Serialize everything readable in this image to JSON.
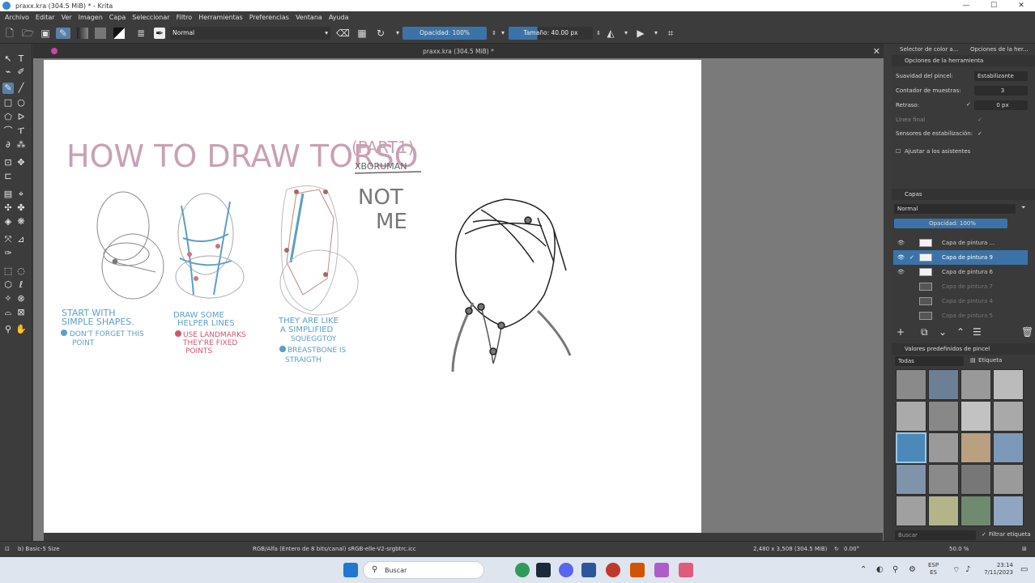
{
  "window": {
    "title": "praxx.kra (304.5 MiB) * - Krita"
  },
  "menu": [
    "Archivo",
    "Editar",
    "Ver",
    "Imagen",
    "Capa",
    "Seleccionar",
    "Filtro",
    "Herramientas",
    "Preferencias",
    "Ventana",
    "Ayuda"
  ],
  "toolbar": {
    "blend_mode": "Normal",
    "opacity": "Opacidad: 100%",
    "size": "Tamaño: 40.00 px"
  },
  "document": {
    "tab_title": "praxx.kra (304.5 MiB) *"
  },
  "canvas_art": {
    "title": "HOW TO DRAW TORSO",
    "part": "(PART1)",
    "author": "XBORUMAN",
    "note_line1": "NOT",
    "note_line2": "ME",
    "caption1_l1": "START WITH",
    "caption1_l2": "SIMPLE SHAPES.",
    "caption1_l3": "DON'T FORGET THIS",
    "caption1_l4": "POINT",
    "caption2_l1": "DRAW SOME",
    "caption2_l2": "HELPER LINES",
    "caption2_l3": "USE LANDMARKS",
    "caption2_l4": "THEY'RE FIXED",
    "caption2_l5": "POINTS",
    "caption3_l1": "THEY ARE LIKE",
    "caption3_l2": "A SIMPLIFIED",
    "caption3_l3": "SQUEGGTOY",
    "caption3_l4": "BREASTBONE IS",
    "caption3_l5": "STRAIGTH"
  },
  "docker": {
    "tab_color": "Selector de color a...",
    "tab_options": "Opciones de la her...",
    "tool_options_title": "Opciones de la herramienta",
    "brush_smoothing_label": "Suavidad del pincel:",
    "brush_smoothing_value": "Estabilizante",
    "sample_count_label": "Contador de muestras:",
    "sample_count_value": "3",
    "delay_label": "Retraso:",
    "delay_value": "0 px",
    "finish_line_label": "Línea final",
    "stabilize_sensors_label": "Sensores de estabilización:",
    "snap_label": "Ajustar a los asistentes",
    "layers_title": "Capas",
    "layers_blend": "Normal",
    "layers_opacity": "Opacidad: 100%",
    "layers": [
      "Capa de pintura ...",
      "Capa de pintura 9",
      "Capa de pintura 6",
      "Capa de pintura 7",
      "Capa de pintura 4",
      "Capa de pintura 5"
    ],
    "presets_title": "Valores predefinidos de pincel",
    "presets_filter": "Todas",
    "presets_tag": "Etiqueta",
    "presets_search": "Buscar",
    "presets_filter_tag": "Filtrar etiqueta"
  },
  "status": {
    "brush": "b) Basic-5 Size",
    "color_space": "RGB/Alfa (Entero de 8 bits/canal)  sRGB-elle-V2-srgbtrc.icc",
    "dimensions": "2,480 x 3,508 (304.5 MiB)",
    "rotation": "0.00°",
    "zoom": "50.0 %"
  },
  "taskbar": {
    "search": "Buscar",
    "lang1": "ESP",
    "lang2": "ES",
    "time": "23:14",
    "date": "7/11/2023"
  },
  "colors": {
    "accent": "#3b73a8",
    "canvas_bg": "#7a7a7a",
    "ui_dark": "#3c3c3c",
    "title_pink": "#c9a0b5",
    "caption_blue": "#5b9fc7",
    "caption_red": "#d4556c"
  }
}
